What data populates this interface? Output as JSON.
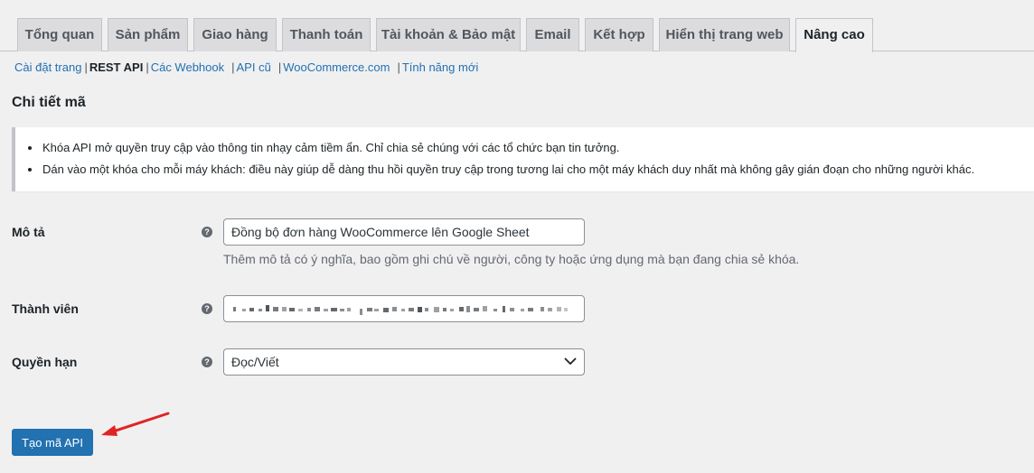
{
  "tabs": [
    {
      "label": "Tổng quan",
      "active": false
    },
    {
      "label": "Sản phẩm",
      "active": false
    },
    {
      "label": "Giao hàng",
      "active": false
    },
    {
      "label": "Thanh toán",
      "active": false
    },
    {
      "label": "Tài khoản & Bảo mật",
      "active": false
    },
    {
      "label": "Email",
      "active": false
    },
    {
      "label": "Kết hợp",
      "active": false
    },
    {
      "label": "Hiển thị trang web",
      "active": false
    },
    {
      "label": "Nâng cao",
      "active": true
    }
  ],
  "subnav": {
    "items": [
      {
        "label": "Cài đặt trang",
        "current": false
      },
      {
        "label": "REST API",
        "current": true
      },
      {
        "label": "Các Webhook",
        "current": false
      },
      {
        "label": "API cũ",
        "current": false
      },
      {
        "label": "WooCommerce.com",
        "current": false
      },
      {
        "label": "Tính năng mới",
        "current": false
      }
    ],
    "separator": "|"
  },
  "page": {
    "title": "Chi tiết mã"
  },
  "notice": {
    "items": [
      "Khóa API mở quyền truy cập vào thông tin nhạy cảm tiềm ẩn. Chỉ chia sẻ chúng với các tổ chức bạn tin tưởng.",
      "Dán vào một khóa cho mỗi máy khách: điều này giúp dễ dàng thu hồi quyền truy cập trong tương lai cho một máy khách duy nhất mà không gây gián đoạn cho những người khác."
    ]
  },
  "form": {
    "help_glyph": "?",
    "description": {
      "label": "Mô tả",
      "value": "Đồng bộ đơn hàng WooCommerce lên Google Sheet",
      "hint": "Thêm mô tả có ý nghĩa, bao gồm ghi chú về người, công ty hoặc ứng dụng mà bạn đang chia sẻ khóa."
    },
    "user": {
      "label": "Thành viên"
    },
    "permissions": {
      "label": "Quyền hạn",
      "value": "Đọc/Viết"
    }
  },
  "actions": {
    "generate_label": "Tạo mã API"
  },
  "colors": {
    "accent": "#2271b1",
    "background": "#f0f0f1",
    "annotation_arrow": "#e02424"
  }
}
